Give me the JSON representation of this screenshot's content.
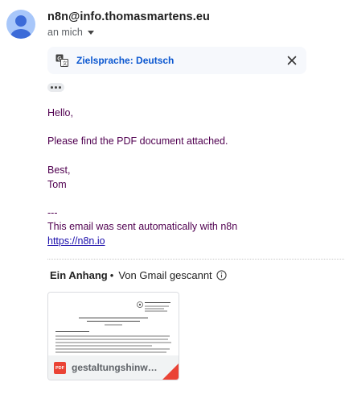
{
  "email": {
    "sender": "n8n@info.thomasmartens.eu",
    "recipient": "an mich"
  },
  "translate": {
    "label": "Zielsprache: Deutsch"
  },
  "body": {
    "greeting": "Hello,",
    "line1": "Please find the PDF document attached.",
    "closing1": "Best,",
    "closing2": "Tom",
    "separator": "---",
    "footer": "This email was sent automatically with n8n",
    "link": "https://n8n.io"
  },
  "attachments": {
    "count_label": "Ein Anhang",
    "dot": "•",
    "scan_label": "Von Gmail gescannt",
    "items": [
      {
        "filename": "gestaltungshinweise",
        "type_badge": "PDF"
      }
    ]
  },
  "colors": {
    "body_text": "#500050",
    "link": "#1a0dab",
    "translate_link": "#0b57d0",
    "pdf_red": "#ea4335"
  }
}
